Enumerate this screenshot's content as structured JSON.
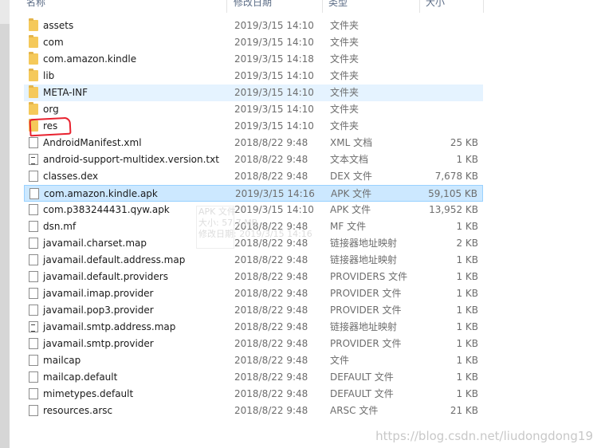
{
  "header": {
    "name": "名称",
    "date": "修改日期",
    "type": "类型",
    "size": "大小"
  },
  "rows": [
    {
      "name": "assets",
      "date": "2019/3/15 14:10",
      "type": "文件夹",
      "size": "",
      "icon": "folder-icon"
    },
    {
      "name": "com",
      "date": "2019/3/15 14:10",
      "type": "文件夹",
      "size": "",
      "icon": "folder-icon"
    },
    {
      "name": "com.amazon.kindle",
      "date": "2019/3/15 14:18",
      "type": "文件夹",
      "size": "",
      "icon": "folder-icon"
    },
    {
      "name": "lib",
      "date": "2019/3/15 14:10",
      "type": "文件夹",
      "size": "",
      "icon": "folder-icon"
    },
    {
      "name": "META-INF",
      "date": "2019/3/15 14:10",
      "type": "文件夹",
      "size": "",
      "icon": "folder-icon"
    },
    {
      "name": "org",
      "date": "2019/3/15 14:10",
      "type": "文件夹",
      "size": "",
      "icon": "folder-icon"
    },
    {
      "name": "res",
      "date": "2019/3/15 14:10",
      "type": "文件夹",
      "size": "",
      "icon": "folder-icon"
    },
    {
      "name": "AndroidManifest.xml",
      "date": "2018/8/22 9:48",
      "type": "XML 文档",
      "size": "25 KB",
      "icon": "file-icon"
    },
    {
      "name": "android-support-multidex.version.txt",
      "date": "2018/8/22 9:48",
      "type": "文本文档",
      "size": "1 KB",
      "icon": "file-icon"
    },
    {
      "name": "classes.dex",
      "date": "2018/8/22 9:48",
      "type": "DEX 文件",
      "size": "7,678 KB",
      "icon": "file-icon"
    },
    {
      "name": "com.amazon.kindle.apk",
      "date": "2019/3/15 14:16",
      "type": "APK 文件",
      "size": "59,105 KB",
      "icon": "file-icon"
    },
    {
      "name": "com.p383244431.qyw.apk",
      "date": "2019/3/15 14:10",
      "type": "APK 文件",
      "size": "13,952 KB",
      "icon": "file-icon"
    },
    {
      "name": "dsn.mf",
      "date": "2018/8/22 9:48",
      "type": "MF 文件",
      "size": "1 KB",
      "icon": "file-icon"
    },
    {
      "name": "javamail.charset.map",
      "date": "2018/8/22 9:48",
      "type": "链接器地址映射",
      "size": "2 KB",
      "icon": "file-icon"
    },
    {
      "name": "javamail.default.address.map",
      "date": "2018/8/22 9:48",
      "type": "链接器地址映射",
      "size": "1 KB",
      "icon": "file-icon"
    },
    {
      "name": "javamail.default.providers",
      "date": "2018/8/22 9:48",
      "type": "PROVIDERS 文件",
      "size": "1 KB",
      "icon": "file-icon"
    },
    {
      "name": "javamail.imap.provider",
      "date": "2018/8/22 9:48",
      "type": "PROVIDER 文件",
      "size": "1 KB",
      "icon": "file-icon"
    },
    {
      "name": "javamail.pop3.provider",
      "date": "2018/8/22 9:48",
      "type": "PROVIDER 文件",
      "size": "1 KB",
      "icon": "file-icon"
    },
    {
      "name": "javamail.smtp.address.map",
      "date": "2018/8/22 9:48",
      "type": "链接器地址映射",
      "size": "1 KB",
      "icon": "file-icon"
    },
    {
      "name": "javamail.smtp.provider",
      "date": "2018/8/22 9:48",
      "type": "PROVIDER 文件",
      "size": "1 KB",
      "icon": "file-icon"
    },
    {
      "name": "mailcap",
      "date": "2018/8/22 9:48",
      "type": "文件",
      "size": "1 KB",
      "icon": "file-icon"
    },
    {
      "name": "mailcap.default",
      "date": "2018/8/22 9:48",
      "type": "DEFAULT 文件",
      "size": "1 KB",
      "icon": "file-icon"
    },
    {
      "name": "mimetypes.default",
      "date": "2018/8/22 9:48",
      "type": "DEFAULT 文件",
      "size": "1 KB",
      "icon": "file-icon"
    },
    {
      "name": "resources.arsc",
      "date": "2018/8/22 9:48",
      "type": "ARSC 文件",
      "size": "21 KB",
      "icon": "file-icon"
    }
  ],
  "tooltip": {
    "line1": "APK 文件",
    "line2": "大小: 57.7 MB",
    "line3": "修改日期: 2019/3/15 14:16"
  },
  "watermark": "https://blog.csdn.net/liudongdong19",
  "colors": {
    "selected": "#cce8ff",
    "hover": "#e5f3ff",
    "annotation": "#e8222f",
    "folder": "#f5c95a"
  }
}
